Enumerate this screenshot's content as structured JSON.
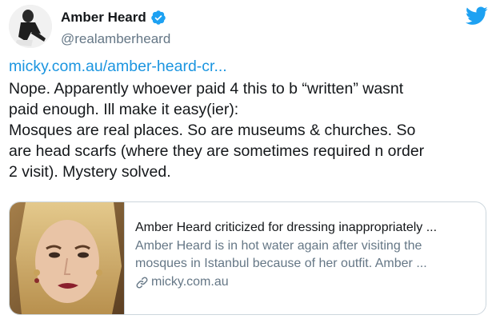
{
  "user": {
    "display_name": "Amber Heard",
    "handle": "@realamberheard",
    "verified": true
  },
  "icons": {
    "brand": "twitter-bird-icon",
    "verified": "verified-badge-icon",
    "link": "link-icon"
  },
  "colors": {
    "link_blue": "#1b95e0",
    "twitter_blue": "#1da1f2",
    "text_primary": "#14171a",
    "text_secondary": "#657786",
    "border": "#ccd6dd"
  },
  "tweet": {
    "link": "micky.com.au/amber-heard-cr...",
    "lines": [
      "Nope. Apparently whoever paid 4 this to b “written” wasnt",
      "paid enough.  Ill make it easy(ier):",
      "Mosques are real places. So are museums & churches. So",
      "are head scarfs (where they are sometimes required n order",
      "2 visit). Mystery solved."
    ]
  },
  "card": {
    "title": "Amber Heard criticized for dressing inappropriately ...",
    "description_lines": [
      "Amber Heard is in hot water again after visiting the",
      "mosques in Istanbul because of her outfit. Amber ..."
    ],
    "domain": "micky.com.au"
  }
}
